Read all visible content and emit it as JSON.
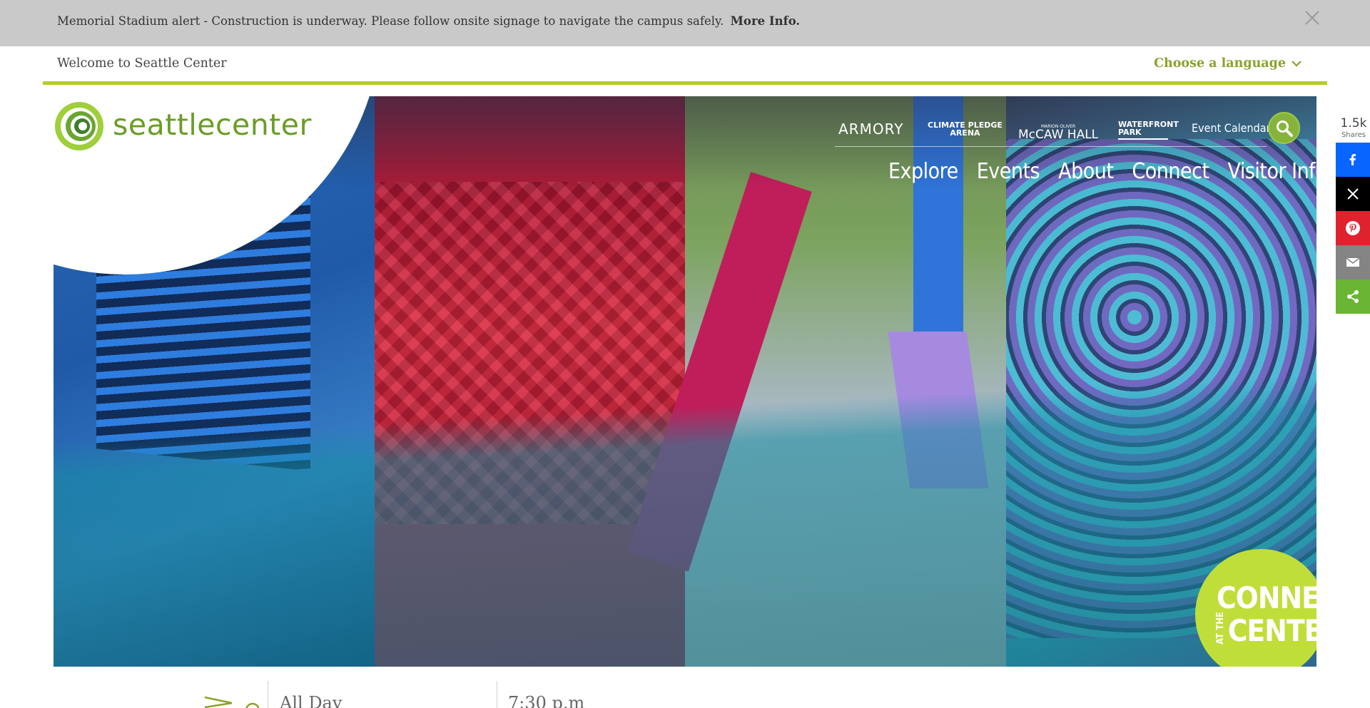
{
  "alert": {
    "text": "Memorial Stadium alert - Construction is underway. Please follow onsite signage to navigate the campus safely.",
    "link": "More Info."
  },
  "utility": {
    "welcome": "Welcome to Seattle Center",
    "language": "Choose a language"
  },
  "logo": {
    "text": "seattlecenter"
  },
  "partners": {
    "armory": "ARMORY",
    "climate_line1": "CLIMATE PLEDGE",
    "climate_line2": "ARENA",
    "mccaw_small": "MARION OLIVER",
    "mccaw": "McCAW HALL",
    "waterfront_line1": "WATERFRONT",
    "waterfront_line2": "PARK"
  },
  "event_calendar": "Event Calendar",
  "nav": [
    "Explore",
    "Events",
    "About",
    "Connect",
    "Visitor Info"
  ],
  "badge": {
    "line1": "CONNECT",
    "small": "AT THE",
    "line2": "CENTER"
  },
  "share": {
    "count": "1.5k",
    "label": "Shares",
    "buttons": [
      "facebook",
      "x",
      "pinterest",
      "email",
      "share"
    ]
  },
  "events": {
    "time1": "All Day",
    "time2": "7:30 p.m"
  },
  "colors": {
    "brand_green": "#8aa32b",
    "rule_green": "#b6cc2c",
    "badge_green": "#c0de3a",
    "facebook": "#0866ff",
    "pinterest": "#e0222e",
    "share": "#6ab533"
  }
}
